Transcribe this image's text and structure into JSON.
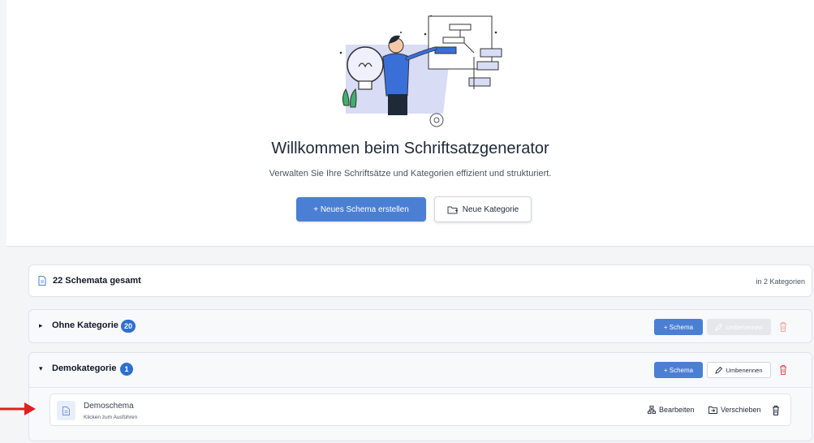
{
  "hero": {
    "title": "Willkommen beim Schriftsatzgenerator",
    "subtitle": "Verwalten Sie Ihre Schriftsätze und Kategorien effizient und strukturiert.",
    "new_schema_label": "+  Neues Schema erstellen",
    "new_category_label": "Neue Kategorie"
  },
  "summary": {
    "title": "22 Schemata gesamt",
    "right_text": "in 2 Kategorien"
  },
  "categories": [
    {
      "name": "Ohne Kategorie",
      "count": "20",
      "add_label": "+ Schema",
      "rename_label": "Umbenennen",
      "expanded": false
    },
    {
      "name": "Demokategorie",
      "count": "1",
      "add_label": "+ Schema",
      "rename_label": "Umbenennen",
      "expanded": true,
      "items": [
        {
          "name": "Demoschema",
          "hint": "Klicken zum Ausführen",
          "edit_label": "Bearbeiten",
          "move_label": "Verschieben"
        }
      ]
    }
  ],
  "colors": {
    "accent": "#4a7fd4",
    "badge": "#2f6fd0",
    "danger": "#e05252",
    "annotation_arrow": "#e02020"
  },
  "icons": {
    "summary": "document-icon",
    "new_category": "folder-plus-icon",
    "rename": "pencil-icon",
    "delete": "trash-icon",
    "edit": "sitemap-icon",
    "move": "folder-move-icon"
  }
}
